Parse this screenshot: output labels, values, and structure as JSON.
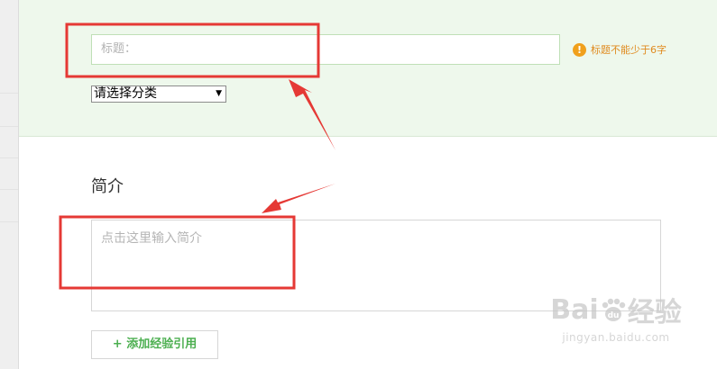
{
  "form": {
    "title_placeholder": "标题：",
    "title_warning": "标题不能少于6字",
    "warning_glyph": "!",
    "category_selected": "请选择分类",
    "intro_heading": "简介",
    "intro_placeholder": "点击这里输入简介",
    "add_reference_label": "+ 添加经验引用"
  },
  "watermark": {
    "brand_left": "Bai",
    "brand_right": "经验",
    "brand_paw_text": "du",
    "domain": "jingyan.baidu.com"
  },
  "colors": {
    "panel_bg": "#eef8ec",
    "warning": "#f0a01c",
    "accent_green": "#4caf50",
    "annotation_red": "#e53935"
  }
}
